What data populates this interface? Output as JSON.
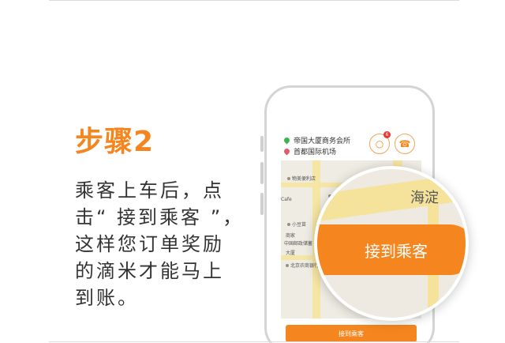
{
  "step": {
    "title": "步骤2",
    "desc_lines": [
      "乘客上车后，点",
      "击“ 接到乘客 ”，",
      "这样您订单奖励",
      "的滴米才能马上",
      "到账。"
    ]
  },
  "phone": {
    "pickup": "帝国大厦商务会所",
    "destination": "首都国际机场",
    "chat_badge": "6",
    "map_labels": [
      "物美便利店",
      "君和",
      "小豆苗",
      "中国邮政储蓄",
      "北京农商银行",
      "大厦",
      "Cafe",
      "商家"
    ],
    "confirm_label": "接到乘客"
  },
  "magnifier": {
    "button_label": "接到乘客",
    "map_label": "海淀"
  },
  "colors": {
    "accent": "#f5861f",
    "text": "#333333"
  }
}
